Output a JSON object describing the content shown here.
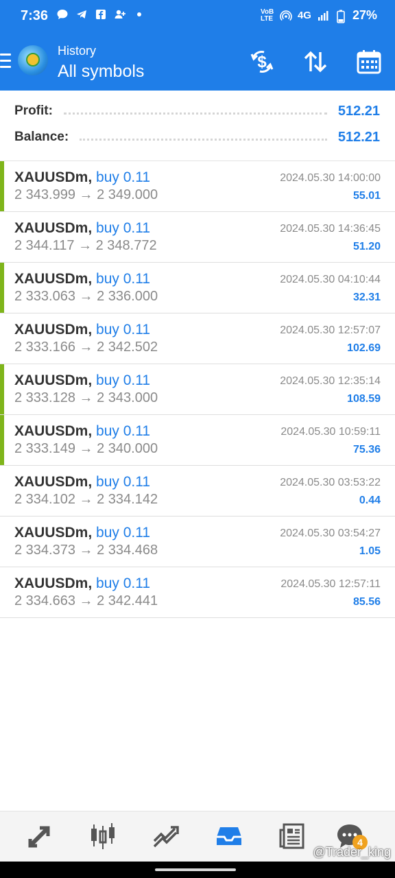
{
  "status": {
    "time": "7:36",
    "battery": "27%",
    "network": "4G",
    "volte": "VoB LTE"
  },
  "header": {
    "subtitle": "History",
    "title": "All symbols",
    "actions": [
      "currency-exchange-icon",
      "sort-icon",
      "calendar-icon"
    ]
  },
  "summary": {
    "profit_label": "Profit:",
    "profit_value": "512.21",
    "balance_label": "Balance:",
    "balance_value": "512.21"
  },
  "trades": [
    {
      "symbol": "XAUUSDm,",
      "direction": "buy 0.11",
      "open": "2 343.999",
      "close": "2 349.000",
      "datetime": "2024.05.30 14:00:00",
      "profit": "55.01",
      "marked": true
    },
    {
      "symbol": "XAUUSDm,",
      "direction": "buy 0.11",
      "open": "2 344.117",
      "close": "2 348.772",
      "datetime": "2024.05.30 14:36:45",
      "profit": "51.20",
      "marked": false
    },
    {
      "symbol": "XAUUSDm,",
      "direction": "buy 0.11",
      "open": "2 333.063",
      "close": "2 336.000",
      "datetime": "2024.05.30 04:10:44",
      "profit": "32.31",
      "marked": true
    },
    {
      "symbol": "XAUUSDm,",
      "direction": "buy 0.11",
      "open": "2 333.166",
      "close": "2 342.502",
      "datetime": "2024.05.30 12:57:07",
      "profit": "102.69",
      "marked": false
    },
    {
      "symbol": "XAUUSDm,",
      "direction": "buy 0.11",
      "open": "2 333.128",
      "close": "2 343.000",
      "datetime": "2024.05.30 12:35:14",
      "profit": "108.59",
      "marked": true
    },
    {
      "symbol": "XAUUSDm,",
      "direction": "buy 0.11",
      "open": "2 333.149",
      "close": "2 340.000",
      "datetime": "2024.05.30 10:59:11",
      "profit": "75.36",
      "marked": true
    },
    {
      "symbol": "XAUUSDm,",
      "direction": "buy 0.11",
      "open": "2 334.102",
      "close": "2 334.142",
      "datetime": "2024.05.30 03:53:22",
      "profit": "0.44",
      "marked": false
    },
    {
      "symbol": "XAUUSDm,",
      "direction": "buy 0.11",
      "open": "2 334.373",
      "close": "2 334.468",
      "datetime": "2024.05.30 03:54:27",
      "profit": "1.05",
      "marked": false
    },
    {
      "symbol": "XAUUSDm,",
      "direction": "buy 0.11",
      "open": "2 334.663",
      "close": "2 342.441",
      "datetime": "2024.05.30 12:57:11",
      "profit": "85.56",
      "marked": false
    }
  ],
  "arrow": "→",
  "bottom_nav": {
    "items": [
      "trade-icon",
      "chart-icon",
      "trend-icon",
      "history-icon",
      "news-icon",
      "messages-icon"
    ],
    "messages_badge": "4",
    "active_color": "#1f7ee8"
  },
  "watermark": "@Trader_king",
  "colors": {
    "accent": "#1f7ee8",
    "profit_bar": "#7fb51b"
  }
}
